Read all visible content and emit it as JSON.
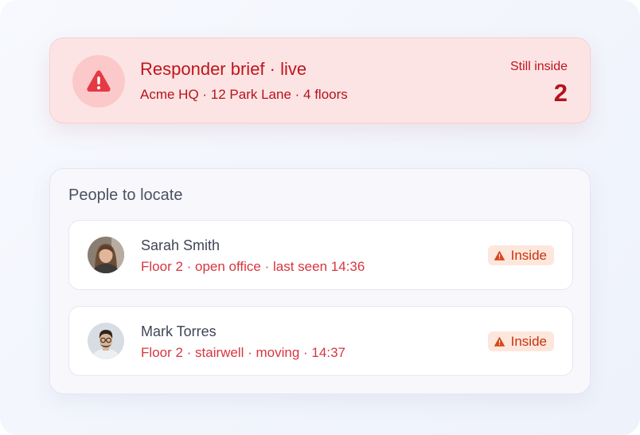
{
  "alert": {
    "title": "Responder brief · live",
    "subtitle": "Acme HQ · 12 Park Lane · 4 floors",
    "still_inside_label": "Still inside",
    "still_inside_count": "2",
    "icon": "warning-triangle-icon",
    "colors": {
      "background": "#fde4e4",
      "accent": "#c0151c"
    }
  },
  "people": {
    "title": "People to locate",
    "items": [
      {
        "name": "Sarah Smith",
        "detail": "Floor 2 · open office · last seen 14:36",
        "status": "Inside",
        "avatar": "avatar-photo"
      },
      {
        "name": "Mark Torres",
        "detail": "Floor 2 · stairwell · moving · 14:37",
        "status": "Inside",
        "avatar": "avatar-photo"
      }
    ],
    "colors": {
      "detail": "#d8363f",
      "badge_bg": "#fde7dc",
      "badge_text": "#c7330f"
    }
  }
}
